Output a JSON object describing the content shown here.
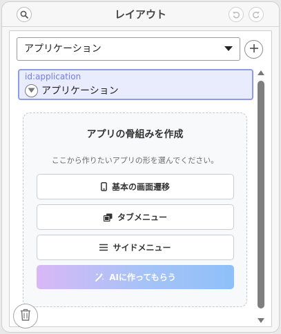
{
  "header": {
    "title": "レイアウト",
    "search_icon": "search-icon",
    "undo_icon": "undo-icon",
    "redo_icon": "redo-icon"
  },
  "app_select": {
    "value": "アプリケーション",
    "add_icon": "plus-icon"
  },
  "app_card": {
    "id_label": "id:application",
    "name": "アプリケーション",
    "toggle_icon": "chevron-down-circle-icon"
  },
  "empty_state": {
    "title": "アプリの骨組みを作成",
    "description": "ここから作りたいアプリの形を選んでください。",
    "options": [
      {
        "label": "基本の画面遷移",
        "icon": "phone-icon"
      },
      {
        "label": "タブメニュー",
        "icon": "tabs-icon"
      },
      {
        "label": "サイドメニュー",
        "icon": "menu-icon"
      }
    ],
    "ai_button": {
      "label": "AIに作ってもらう",
      "icon": "magic-wand-icon"
    }
  },
  "footer": {
    "trash_icon": "trash-icon"
  },
  "colors": {
    "accent": "#8d9be9",
    "accent_text": "#6f7fe2",
    "card_bg": "#e9ecfc",
    "ai_gradient_start": "#d9b8f6",
    "ai_gradient_end": "#8fc0f8"
  }
}
